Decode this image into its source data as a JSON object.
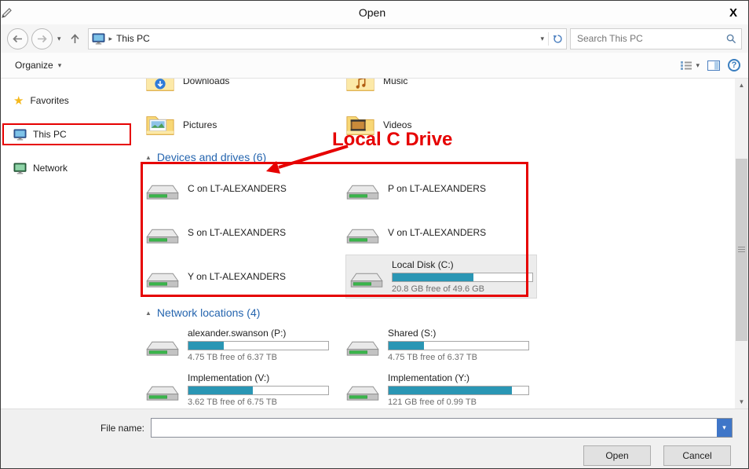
{
  "colors": {
    "bar-accent": "#2a96b4",
    "annotation-red": "#e60000",
    "header-blue": "#2565af",
    "star-gold": "#f5b81c"
  },
  "window": {
    "title": "Open",
    "close_label": "X"
  },
  "nav": {
    "breadcrumb": "This PC",
    "search_placeholder": "Search This PC"
  },
  "toolbar": {
    "organize_label": "Organize"
  },
  "sidebar": {
    "items": [
      {
        "label": "Favorites"
      },
      {
        "label": "This PC"
      },
      {
        "label": "Network"
      }
    ]
  },
  "folders": {
    "items": [
      "Downloads",
      "Music",
      "Pictures",
      "Videos"
    ]
  },
  "devices": {
    "header": "Devices and drives (6)",
    "items": [
      {
        "name": "C on LT-ALEXANDERS"
      },
      {
        "name": "P on LT-ALEXANDERS"
      },
      {
        "name": "S on LT-ALEXANDERS"
      },
      {
        "name": "V on LT-ALEXANDERS"
      },
      {
        "name": "Y on LT-ALEXANDERS"
      },
      {
        "name": "Local Disk (C:)",
        "free_text": "20.8 GB free of 49.6 GB",
        "used_percent": 58
      }
    ]
  },
  "network": {
    "header": "Network locations (4)",
    "items": [
      {
        "name": "alexander.swanson (P:)",
        "free_text": "4.75 TB free of 6.37 TB",
        "used_percent": 25
      },
      {
        "name": "Shared (S:)",
        "free_text": "4.75 TB free of 6.37 TB",
        "used_percent": 25
      },
      {
        "name": "Implementation (V:)",
        "free_text": "3.62 TB free of 6.75 TB",
        "used_percent": 46
      },
      {
        "name": "Implementation (Y:)",
        "free_text": "121 GB free of 0.99 TB",
        "used_percent": 88
      }
    ]
  },
  "annotation": {
    "label": "Local C Drive"
  },
  "footer": {
    "filename_label": "File name:",
    "filename_value": "",
    "open_label": "Open",
    "cancel_label": "Cancel"
  }
}
